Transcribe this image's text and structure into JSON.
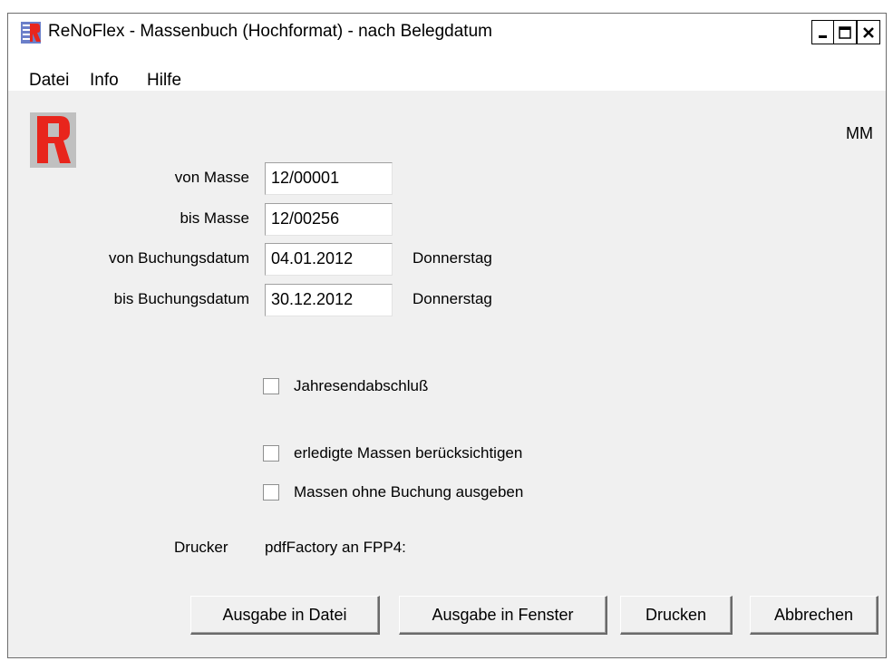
{
  "window": {
    "title": "ReNoFlex - Massenbuch (Hochformat) - nach Belegdatum",
    "app_icon": "renoflex-app-icon",
    "controls": {
      "minimize": "minimize-icon",
      "maximize": "maximize-icon",
      "close": "close-icon"
    }
  },
  "menu": {
    "items": [
      "Datei",
      "Info",
      "Hilfe"
    ]
  },
  "header": {
    "logo_icon": "renoflex-r-logo-icon",
    "logo_color": "#e8251c",
    "user_initials": "MM"
  },
  "form": {
    "von_masse": {
      "label": "von Masse",
      "value": "12/00001"
    },
    "bis_masse": {
      "label": "bis Masse",
      "value": "12/00256"
    },
    "von_datum": {
      "label": "von Buchungsdatum",
      "value": "04.01.2012",
      "weekday": "Donnerstag"
    },
    "bis_datum": {
      "label": "bis Buchungsdatum",
      "value": "30.12.2012",
      "weekday": "Donnerstag"
    }
  },
  "options": {
    "jahresabschluss": {
      "label": "Jahresendabschluß",
      "checked": false
    },
    "erledigte": {
      "label": "erledigte Massen berücksichtigen",
      "checked": false
    },
    "ohne_buchung": {
      "label": "Massen ohne Buchung ausgeben",
      "checked": false
    }
  },
  "printer": {
    "label": "Drucker",
    "value": "pdfFactory an FPP4:"
  },
  "buttons": {
    "datei": "Ausgabe in Datei",
    "fenster": "Ausgabe in Fenster",
    "drucken": "Drucken",
    "abbrechen": "Abbrechen"
  }
}
